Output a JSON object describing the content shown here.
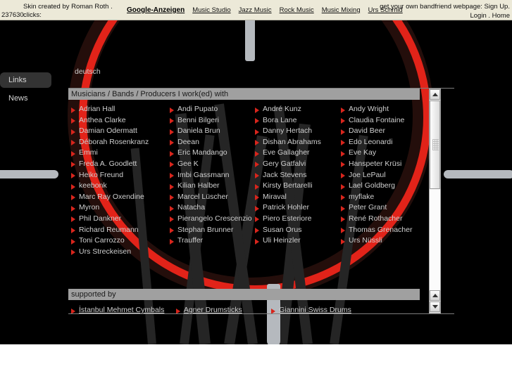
{
  "adbar": {
    "skin_note": "Skin created by Roman Roth . clicks:",
    "clicks": "237630",
    "ads_title": "Google-Anzeigen",
    "ads": [
      {
        "label": "Music Studio"
      },
      {
        "label": "Jazz Music"
      },
      {
        "label": "Rock Music"
      },
      {
        "label": "Music Mixing"
      },
      {
        "label": "Urs Schmid"
      }
    ],
    "promo_text": "get your own bandfriend webpage:",
    "promo_signup": "Sign Up",
    "promo_login": "Login",
    "promo_home": "Home",
    "dot": "."
  },
  "leftnav": {
    "items": [
      {
        "label": "Links",
        "active": true
      },
      {
        "label": "News",
        "active": false
      }
    ]
  },
  "language_link": "deutsch",
  "sections": {
    "musicians_heading": "Musicians / Bands / Producers I work(ed) with",
    "supported_heading": "supported by"
  },
  "columns": [
    [
      "Adrian Hall",
      "Anthea Clarke",
      "Damian Odermatt",
      "Déborah Rosenkranz",
      "Emmi",
      "Freda A. Goodlett",
      "Heiko Freund",
      "keebonk",
      "Marc Ray Oxendine",
      "Myron",
      "Phil Dankner",
      "Richard Reumann",
      "Toni Carrozzo",
      "Urs Streckeisen"
    ],
    [
      "Andi Pupato",
      "Benni Bilgeri",
      "Daniela Brun",
      "Deean",
      "Eric Mandango",
      "Gee K",
      "Imbi Gassmann",
      "Kilian Halber",
      "Marcel Lüscher",
      "Natacha",
      "Pierangelo Crescenzio",
      "Stephan Brunner",
      "Trauffer"
    ],
    [
      "André Kunz",
      "Bora Lane",
      "Danny Hertach",
      "Dishan Abrahams",
      "Eve Gallagher",
      "Gery Gatfalvi",
      "Jack Stevens",
      "Kirsty Bertarelli",
      "Miraval",
      "Patrick Hohler",
      "Piero Esteriore",
      "Susan Orus",
      "Uli Heinzler"
    ],
    [
      "Andy Wright",
      "Claudia Fontaine",
      "David Beer",
      "Edo Leonardi",
      "Eve Kay",
      "Hanspeter Krüsi",
      "Joe LePaul",
      "Lael Goldberg",
      "myflake",
      "Peter Grant",
      "René Rothacher",
      "Thomas Grenacher",
      "Urs Nüssli"
    ]
  ],
  "supported_by": [
    "İstanbul Mehmet Cymbals",
    "Agner Drumsticks",
    "Giannini Swiss Drums"
  ],
  "colors": {
    "accent_red": "#e22319",
    "bullet_red": "#d8251c",
    "stage_black": "#000000",
    "adbar_beige": "#ece9d8",
    "heading_gray": "#a0a0a0",
    "text_gray": "#cfcfcf",
    "stick_gray": "#b5b9be"
  }
}
